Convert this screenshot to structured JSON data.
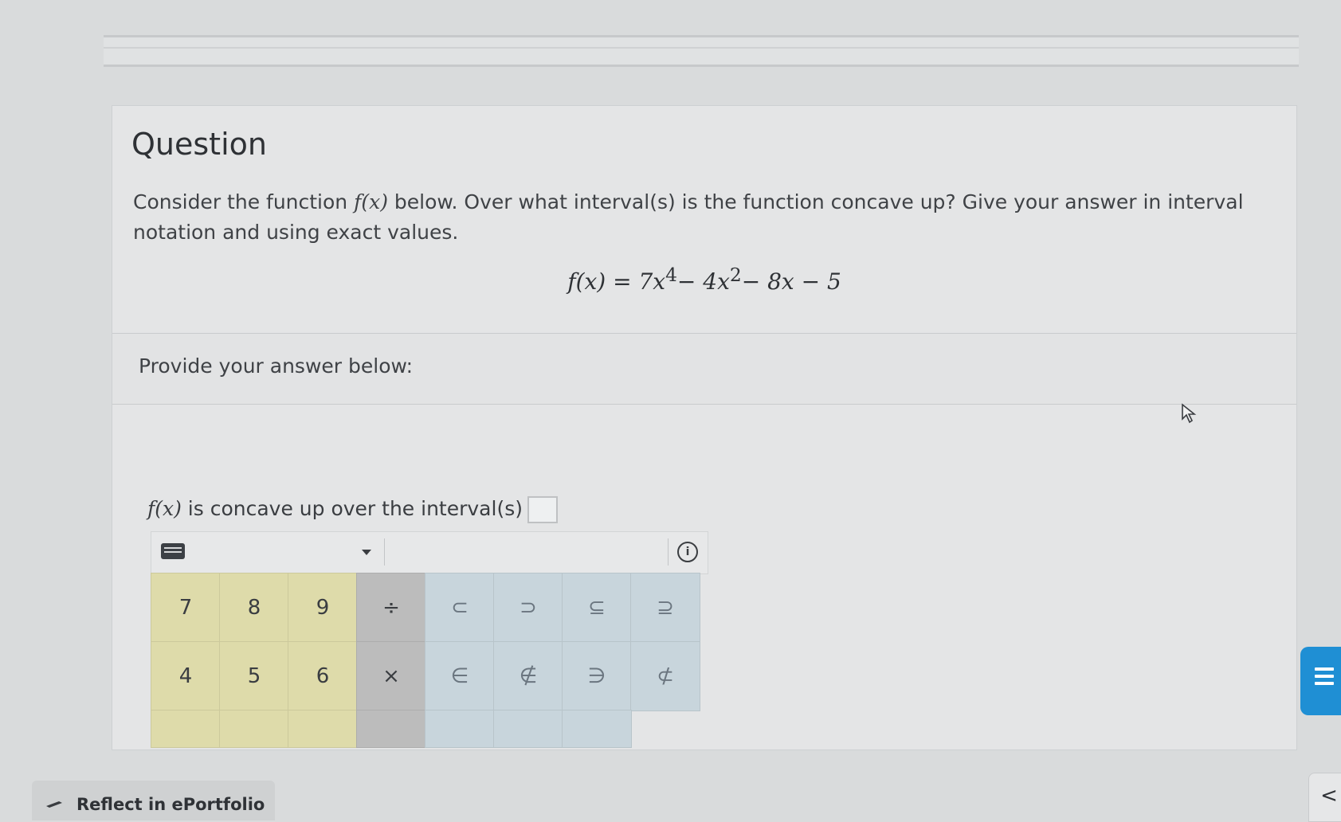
{
  "question": {
    "title": "Question",
    "text_prefix": "Consider the function ",
    "text_func": "f(x)",
    "text_suffix": " below. Over what interval(s) is the function concave up? Give your answer in interval notation and using exact values.",
    "formula": {
      "lhs": "f(x) = 7x",
      "exp1": "4",
      "mid1": " − 4x",
      "exp2": "2",
      "rest": " − 8x − 5"
    }
  },
  "answer": {
    "prompt": "Provide your answer below:",
    "label_func": "f(x)",
    "label_text": " is concave up over the interval(s)"
  },
  "keypad": {
    "rows": [
      [
        "7",
        "8",
        "9",
        "÷",
        "⊂",
        "⊃",
        "⊆",
        "⊇"
      ],
      [
        "4",
        "5",
        "6",
        "×",
        "∈",
        "∉",
        "∋",
        "⊄"
      ]
    ],
    "info_icon": "ⓘ"
  },
  "footer": {
    "reflect_label": "Reflect in ePortfolio",
    "side_arrow": "<"
  },
  "colors": {
    "numeric_key": "#dedbaa",
    "operator_key": "#bcbcbc",
    "set_key": "#c8d5dc",
    "chat_button": "#1f8fd4"
  }
}
